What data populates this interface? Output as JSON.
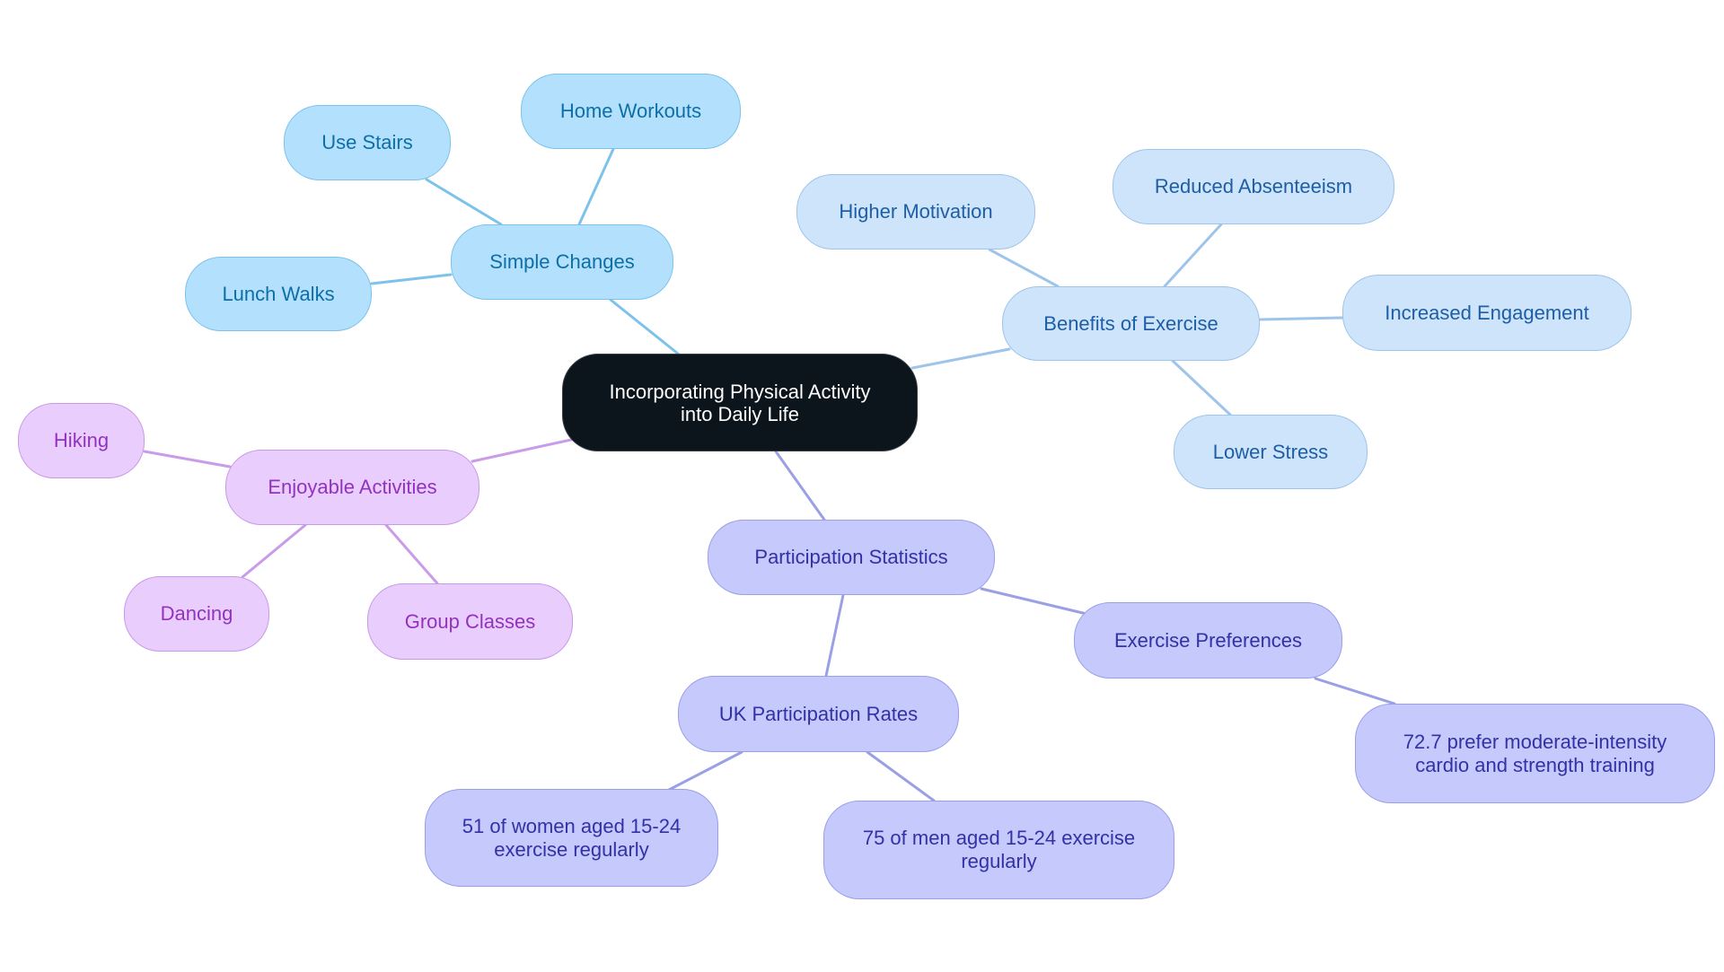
{
  "diagram": {
    "type": "mind-map",
    "colors": {
      "root": "#0c141c",
      "simple_changes_branch": "#b3e0fd",
      "benefits_branch": "#cde4fb",
      "enjoyable_branch": "#e9cdfc",
      "statistics_branch": "#c6c9fc",
      "edge_sky": "#7cc2ea",
      "edge_blue": "#9fc4ea",
      "edge_lavender": "#c99be8",
      "edge_indigo": "#9a9fe6"
    },
    "root": {
      "label": "Incorporating Physical Activity into Daily Life",
      "line1": "Incorporating Physical Activity",
      "line2": "into Daily Life"
    },
    "branches": {
      "simple_changes": {
        "label": "Simple Changes",
        "children": [
          "Use Stairs",
          "Home Workouts",
          "Lunch Walks"
        ]
      },
      "benefits": {
        "label": "Benefits of Exercise",
        "children": [
          "Higher Motivation",
          "Reduced Absenteeism",
          "Increased Engagement",
          "Lower Stress"
        ]
      },
      "enjoyable": {
        "label": "Enjoyable Activities",
        "children": [
          "Hiking",
          "Dancing",
          "Group Classes"
        ]
      },
      "statistics": {
        "label": "Participation Statistics",
        "uk_rates": {
          "label": "UK Participation Rates",
          "women": {
            "line1": "51 of women aged 15-24",
            "line2": "exercise regularly"
          },
          "men": {
            "line1": "75 of men aged 15-24 exercise",
            "line2": "regularly"
          }
        },
        "preferences": {
          "label": "Exercise Preferences",
          "detail": {
            "line1": "72.7 prefer moderate-intensity",
            "line2": "cardio and strength training"
          }
        }
      }
    }
  }
}
